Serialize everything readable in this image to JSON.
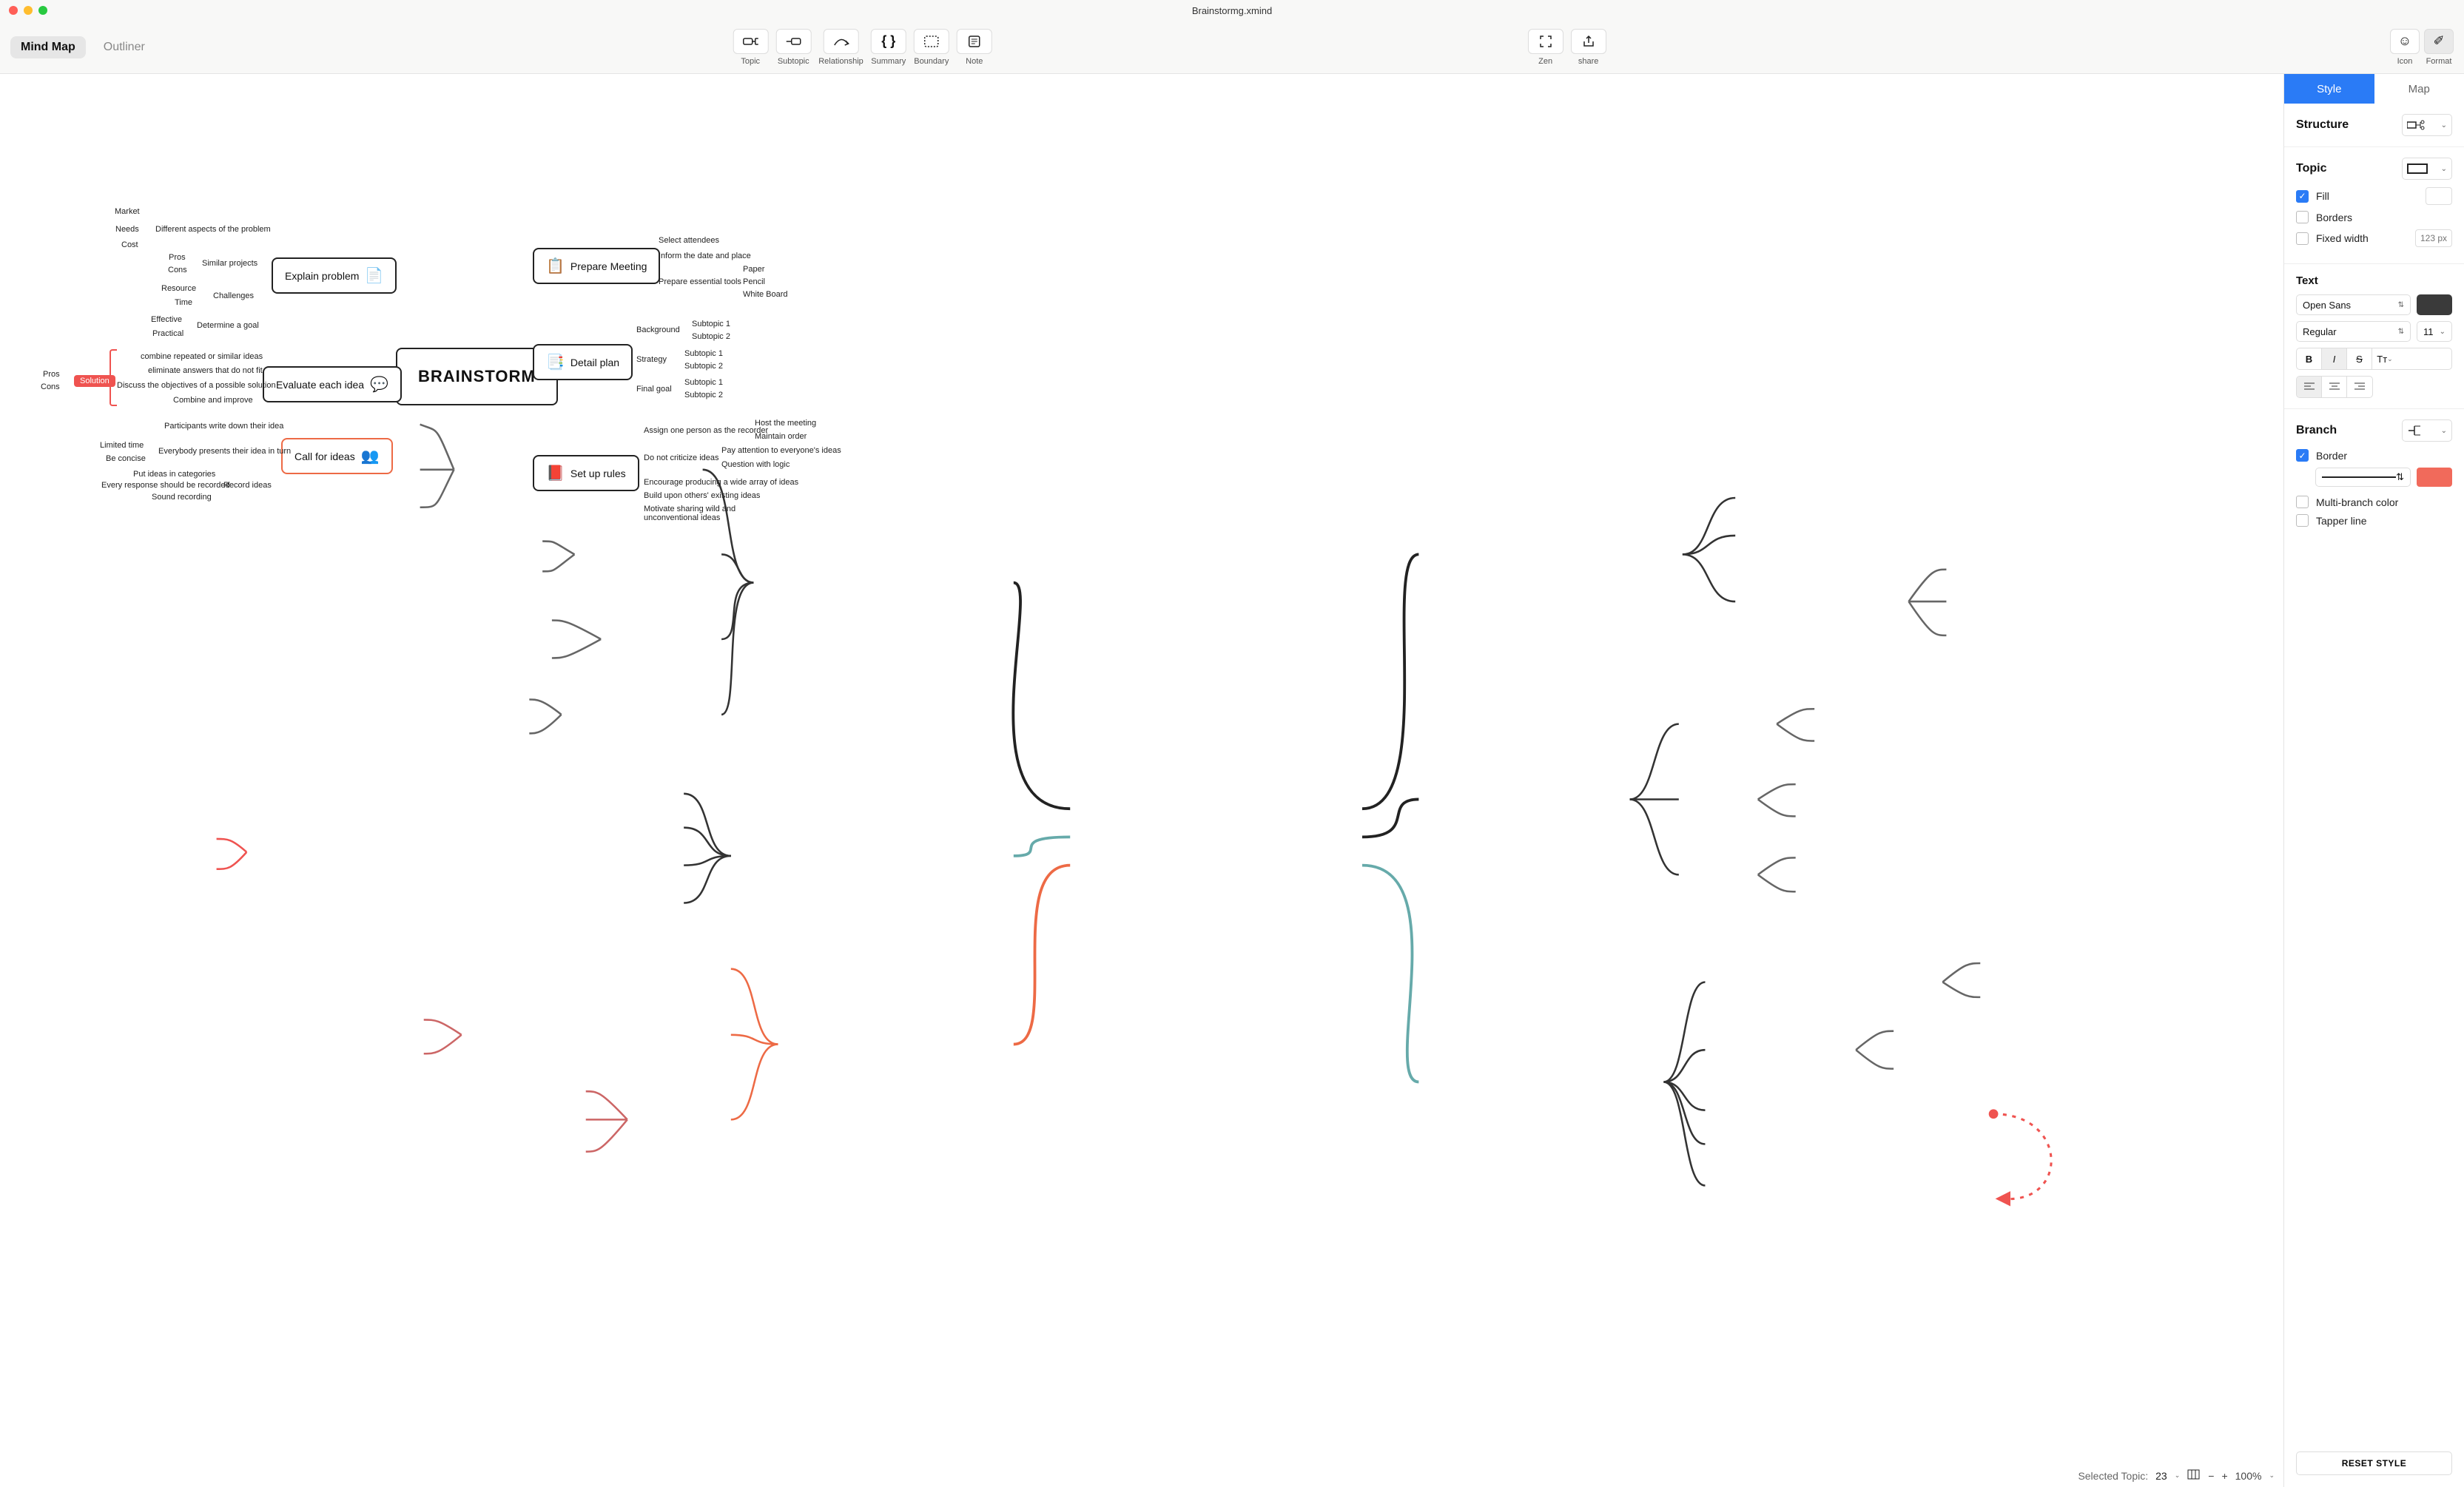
{
  "window": {
    "title": "Brainstormg.xmind"
  },
  "view_tabs": {
    "mindmap": "Mind Map",
    "outliner": "Outliner"
  },
  "tools": {
    "topic": "Topic",
    "subtopic": "Subtopic",
    "relationship": "Relationship",
    "summary": "Summary",
    "boundary": "Boundary",
    "note": "Note",
    "zen": "Zen",
    "share": "share",
    "icon": "Icon",
    "format": "Format"
  },
  "panel": {
    "tabs": {
      "style": "Style",
      "map": "Map"
    },
    "structure_label": "Structure",
    "topic_label": "Topic",
    "fill_label": "Fill",
    "borders_label": "Borders",
    "fixed_width_label": "Fixed width",
    "fixed_width_placeholder": "123 px",
    "text_label": "Text",
    "font_family": "Open Sans",
    "font_weight": "Regular",
    "font_size": "11",
    "text_color": "#3a3a3a",
    "branch_label": "Branch",
    "border_label": "Border",
    "border_color": "#f16a5b",
    "multi_branch_label": "Multi-branch color",
    "tapper_line_label": "Tapper line",
    "reset": "RESET STYLE"
  },
  "footer": {
    "selected_label": "Selected Topic:",
    "selected_count": "23",
    "zoom": "100%"
  },
  "mindmap": {
    "central": "BRAINSTORM",
    "left": [
      {
        "title": "Explain problem",
        "icon": "📄",
        "children": [
          {
            "title": "Different aspects of the problem",
            "children": [
              "Market",
              "Needs",
              "Cost"
            ]
          },
          {
            "title": "Similar projects",
            "children": [
              "Pros",
              "Cons"
            ]
          },
          {
            "title": "Challenges",
            "children": [
              "Resource",
              "Time"
            ]
          },
          {
            "title": "Determine a goal",
            "children": [
              "Effective",
              "Practical"
            ]
          }
        ]
      },
      {
        "title": "Evaluate each idea",
        "icon": "💬",
        "children": [
          {
            "title": "combine repeated or similar ideas"
          },
          {
            "title": "eliminate answers that do not fit"
          },
          {
            "title": "Discuss the objectives of a possible solution"
          },
          {
            "title": "Combine and improve"
          }
        ],
        "solution_tag": "Solution",
        "solution_children": [
          "Pros",
          "Cons"
        ]
      },
      {
        "title": "Call for ideas",
        "icon": "👥",
        "highlight": true,
        "children": [
          {
            "title": "Participants write down their idea"
          },
          {
            "title": "Everybody presents their idea in turn",
            "children": [
              "Limited time",
              "Be concise"
            ]
          },
          {
            "title": "Record ideas",
            "children": [
              "Put ideas in categories",
              "Every response should be recorded",
              "Sound recording"
            ]
          }
        ]
      }
    ],
    "right": [
      {
        "title": "Prepare Meeting",
        "icon": "📋",
        "children": [
          {
            "title": "Select attendees"
          },
          {
            "title": "Inform the date and place"
          },
          {
            "title": "Prepare essential tools",
            "children": [
              "Paper",
              "Pencil",
              "White Board"
            ]
          }
        ]
      },
      {
        "title": "Detail plan",
        "icon": "📑",
        "children": [
          {
            "title": "Background",
            "children": [
              "Subtopic 1",
              "Subtopic 2"
            ]
          },
          {
            "title": "Strategy",
            "children": [
              "Subtopic 1",
              "Subtopic 2"
            ]
          },
          {
            "title": "Final goal",
            "children": [
              "Subtopic 1",
              "Subtopic 2"
            ]
          }
        ]
      },
      {
        "title": "Set up rules",
        "icon": "📕",
        "children": [
          {
            "title": "Assign one person as the recorder",
            "children": [
              "Host the meeting",
              "Maintain order"
            ]
          },
          {
            "title": "Do not criticize ideas",
            "children": [
              "Pay attention to everyone's ideas",
              "Question with logic"
            ]
          },
          {
            "title": "Encourage producing a wide array of ideas"
          },
          {
            "title": "Build upon others' existing ideas"
          },
          {
            "title": "Motivate sharing wild and unconventional ideas"
          }
        ]
      }
    ]
  }
}
